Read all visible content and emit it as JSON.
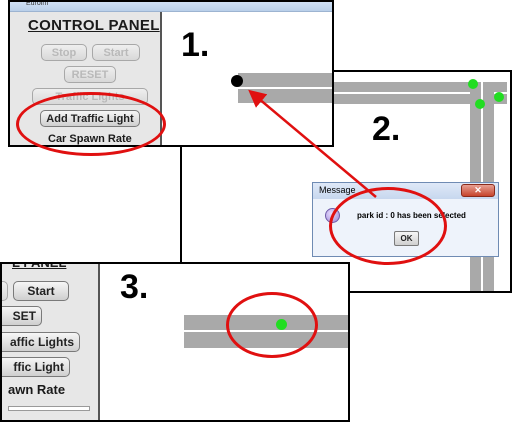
{
  "panel1": {
    "step": "1.",
    "window_title": "Euroim",
    "header": "CONTROL PANEL",
    "stop_label": "Stop",
    "start_label": "Start",
    "reset_label": "RESET",
    "traffic_lights_label": "Traffic Lights",
    "add_traffic_light_label": "Add Traffic Light",
    "spawn_rate_label": "Car Spawn Rate"
  },
  "panel2": {
    "step": "2.",
    "dialog": {
      "title": "Message",
      "message": "park id : 0 has been selected",
      "ok_label": "OK",
      "close_glyph": "✕",
      "info_icon": "info-icon"
    }
  },
  "panel3": {
    "step": "3.",
    "header_fragment": "L PANEL",
    "start_label": "Start",
    "reset_label": "SET",
    "traffic_lights_label": "affic Lights",
    "traffic_light_label": "ffic Light",
    "spawn_rate_label": "awn Rate"
  },
  "colors": {
    "road": "#a9a9a9",
    "traffic_light_green": "#22dd22",
    "highlight_red": "#e01010",
    "panel_gray": "#e7e7e7"
  }
}
